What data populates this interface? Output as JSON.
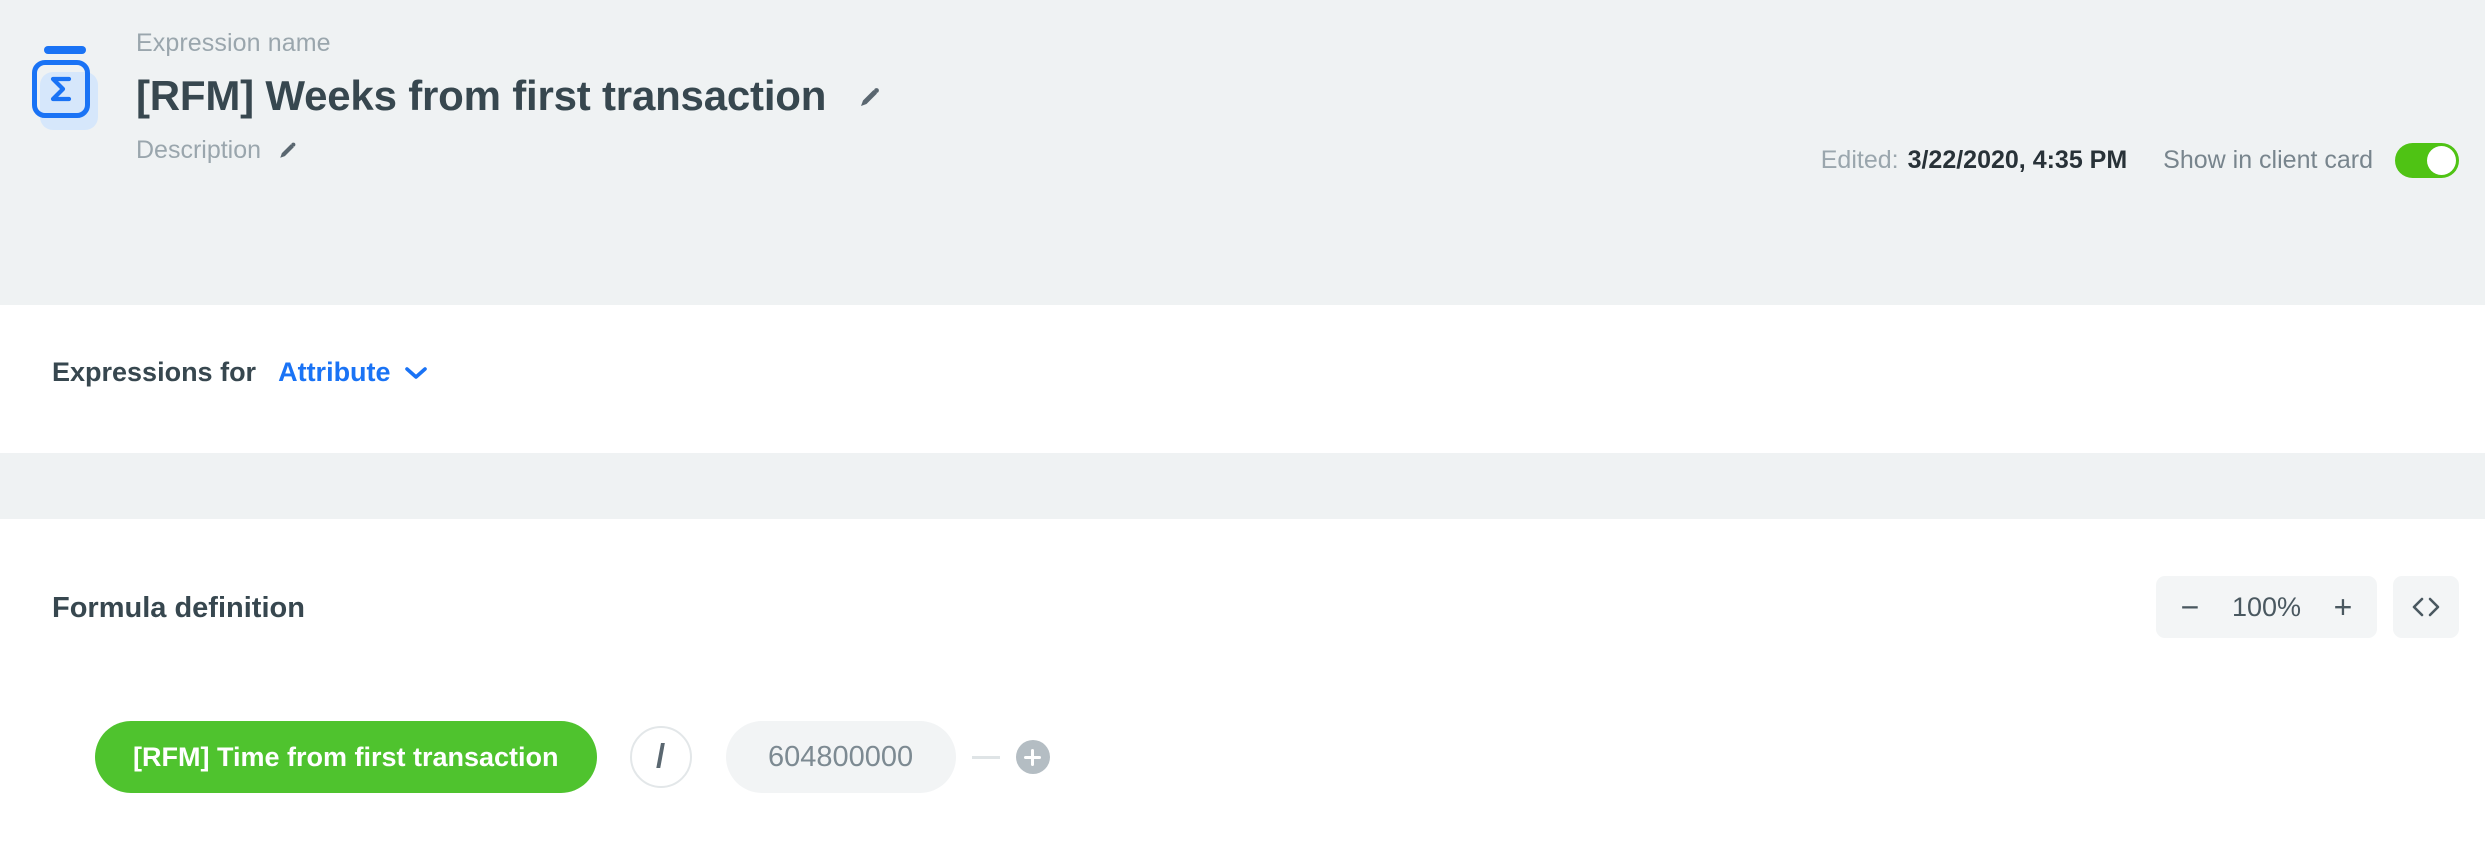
{
  "header": {
    "icon_name": "expression-sigma-icon",
    "expression_name_label": "Expression name",
    "title": "[RFM] Weeks from first transaction",
    "title_edit_icon": "pencil-icon",
    "description_label": "Description",
    "description_edit_icon": "pencil-icon",
    "edited_label": "Edited:",
    "edited_value": "3/22/2020, 4:35 PM",
    "show_in_client_card_label": "Show in client card",
    "toggle_state": "on",
    "toggle_color": "#4fc314"
  },
  "expressions_for": {
    "label": "Expressions for",
    "selected": "Attribute",
    "chevron_icon": "chevron-down-icon",
    "accent_color": "#1a73f5"
  },
  "formula": {
    "section_title": "Formula definition",
    "zoom": {
      "decrease_label": "−",
      "value": "100%",
      "increase_label": "+"
    },
    "code_view_label": "⟨⟩",
    "nodes": {
      "operand_1": "[RFM] Time from first transaction",
      "operator": "/",
      "operand_2": "604800000",
      "add_label": "+"
    },
    "operand_1_color": "#4fc32e",
    "operand_2_color": "#f2f4f5"
  }
}
